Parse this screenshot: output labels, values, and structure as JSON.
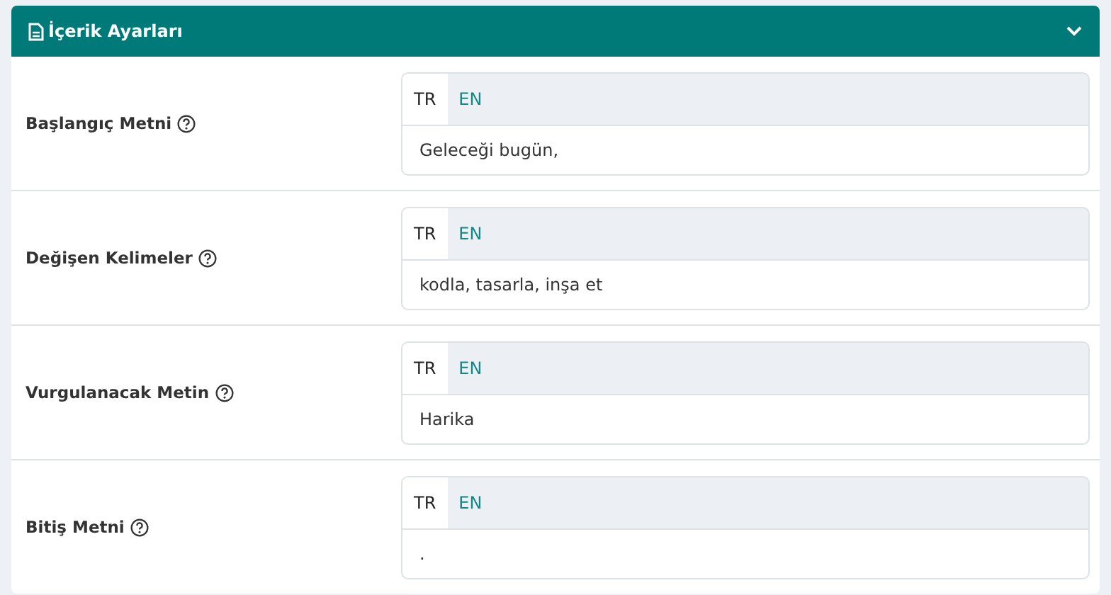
{
  "panel": {
    "title": "İçerik Ayarları",
    "expanded": true
  },
  "fields": [
    {
      "label": "Başlangıç Metni",
      "tabs": [
        {
          "label": "TR",
          "selected": true
        },
        {
          "label": "EN",
          "selected": false
        }
      ],
      "value": "Geleceği bugün,"
    },
    {
      "label": "Değişen Kelimeler",
      "tabs": [
        {
          "label": "TR",
          "selected": true
        },
        {
          "label": "EN",
          "selected": false
        }
      ],
      "value": "kodla, tasarla, inşa et"
    },
    {
      "label": "Vurgulanacak Metin",
      "tabs": [
        {
          "label": "TR",
          "selected": true
        },
        {
          "label": "EN",
          "selected": false
        }
      ],
      "value": "Harika"
    },
    {
      "label": "Bitiş Metni",
      "tabs": [
        {
          "label": "TR",
          "selected": true
        },
        {
          "label": "EN",
          "selected": false
        }
      ],
      "value": "."
    }
  ]
}
